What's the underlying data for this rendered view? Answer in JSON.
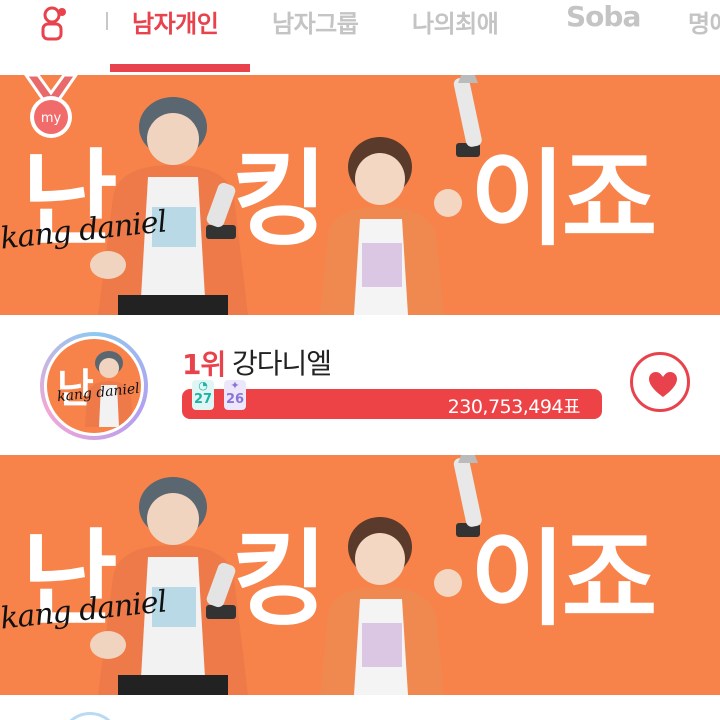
{
  "tabs": {
    "items": [
      {
        "label": "남자개인",
        "active": true
      },
      {
        "label": "남자그룹",
        "active": false
      },
      {
        "label": "나의최애",
        "active": false
      },
      {
        "label": "Soba",
        "active": false
      },
      {
        "label": "명예",
        "active": false
      }
    ]
  },
  "banner": {
    "main_text": [
      "난",
      "킹",
      "이죠"
    ],
    "script_text": "kang daniel",
    "badge_label": "my"
  },
  "ranking": {
    "entries": [
      {
        "rank_label": "1위",
        "name": "강다니엘",
        "badges": [
          "27",
          "26"
        ],
        "votes_label": "230,753,494표"
      }
    ]
  },
  "avatar": {
    "text": "난",
    "script_text": "kang daniel"
  },
  "colors": {
    "accent": "#e8424c",
    "banner_bg": "#f7834b",
    "vote_bar": "#ee4346"
  },
  "icons": {
    "tab_home": "person-icon",
    "favorite": "heart-icon"
  }
}
